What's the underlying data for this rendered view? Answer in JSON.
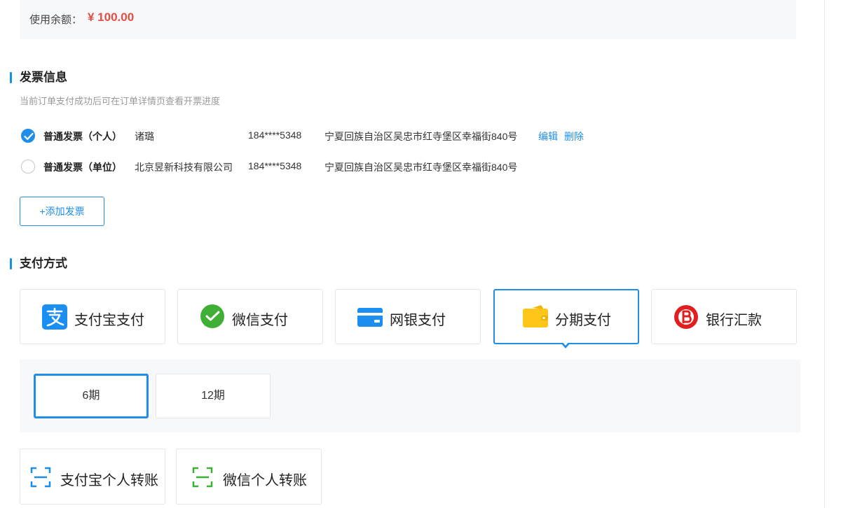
{
  "balance": {
    "label": "使用余额：",
    "amount": "¥ 100.00"
  },
  "invoice": {
    "title": "发票信息",
    "hint": "当前订单支付成功后可在订单详情页查看开票进度",
    "rows": [
      {
        "selected": true,
        "type": "普通发票（个人）",
        "name": "诸璐",
        "phone": "184****5348",
        "address": "宁夏回族自治区吴忠市红寺堡区幸福街840号",
        "edit_label": "编辑",
        "delete_label": "删除"
      },
      {
        "selected": false,
        "type": "普通发票（单位）",
        "name": "北京昱新科技有限公司",
        "phone": "184****5348",
        "address": "宁夏回族自治区吴忠市红寺堡区幸福街840号"
      }
    ],
    "add_label": "+添加发票"
  },
  "payment": {
    "title": "支付方式",
    "methods": [
      {
        "label": "支付宝支付",
        "icon": "alipay-icon"
      },
      {
        "label": "微信支付",
        "icon": "wechat-icon"
      },
      {
        "label": "网银支付",
        "icon": "bank-card-icon"
      },
      {
        "label": "分期支付",
        "icon": "wallet-icon",
        "active": true
      },
      {
        "label": "银行汇款",
        "icon": "bank-transfer-icon"
      }
    ],
    "installments": [
      {
        "label": "6期",
        "active": true
      },
      {
        "label": "12期",
        "active": false
      }
    ],
    "transfers": [
      {
        "label": "支付宝个人转账",
        "icon": "scan-icon",
        "color": "#1f8ee8"
      },
      {
        "label": "微信个人转账",
        "icon": "scan-icon",
        "color": "#3cb034"
      }
    ]
  },
  "colors": {
    "accent": "#1f8ee8",
    "amount": "#e54d42",
    "panel_bg": "#f7f8fa"
  }
}
